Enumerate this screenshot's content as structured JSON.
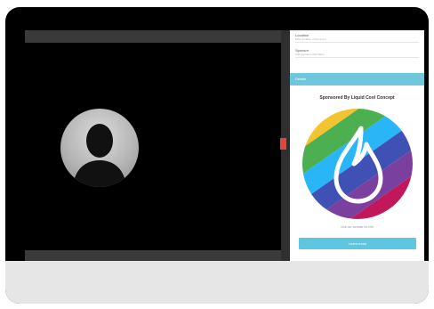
{
  "side_panel": {
    "field1_label": "Location",
    "field1_value": "Enter location of the event",
    "field2_label": "Sponsor",
    "field2_value": "Add sponsor information",
    "tab_label": "Details",
    "sponsor_title": "Sponsored By Liquid Cool Concept",
    "caption": "Visit our website for info",
    "button_label": "Learn more"
  },
  "colors": {
    "accent": "#5ec6e0",
    "handle": "#e0463a"
  }
}
